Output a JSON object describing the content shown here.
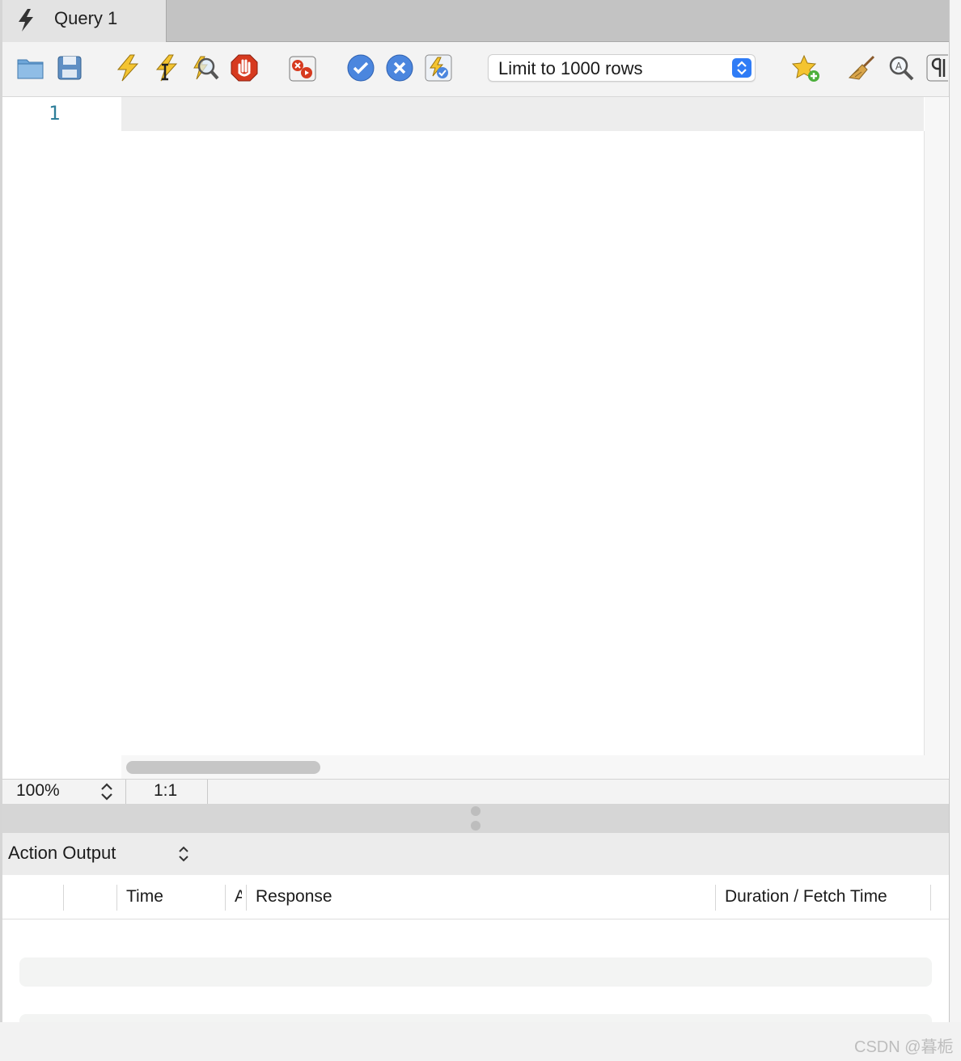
{
  "tab": {
    "label": "Query 1",
    "icon": "lightning-icon"
  },
  "toolbar": {
    "buttons": [
      {
        "name": "open-file-button",
        "icon": "folder-icon"
      },
      {
        "name": "save-button",
        "icon": "floppy-disk-icon"
      },
      {
        "name": "execute-all-button",
        "icon": "lightning-icon"
      },
      {
        "name": "execute-current-button",
        "icon": "lightning-cursor-icon"
      },
      {
        "name": "explain-button",
        "icon": "magnifier-lightning-icon"
      },
      {
        "name": "stop-button",
        "icon": "stop-hand-icon"
      },
      {
        "name": "toggle-continue-on-error-button",
        "icon": "error-toggle-icon"
      },
      {
        "name": "commit-button",
        "icon": "check-circle-icon"
      },
      {
        "name": "rollback-button",
        "icon": "x-circle-icon"
      },
      {
        "name": "autocommit-button",
        "icon": "autocommit-icon"
      },
      {
        "name": "add-snippet-button",
        "icon": "star-plus-icon"
      },
      {
        "name": "beautify-button",
        "icon": "broom-icon"
      },
      {
        "name": "find-button",
        "icon": "search-icon"
      },
      {
        "name": "invisible-chars-button",
        "icon": "pilcrow-icon"
      }
    ],
    "limit_select": {
      "value": "Limit to 1000 rows"
    }
  },
  "editor": {
    "line_numbers": [
      "1"
    ],
    "content": ""
  },
  "status": {
    "zoom": "100%",
    "cursor": "1:1"
  },
  "output": {
    "title": "Action Output",
    "columns": [
      "",
      "",
      "Time",
      "Action",
      "Response",
      "Duration / Fetch Time"
    ]
  },
  "watermark": "CSDN @暮栀",
  "colors": {
    "accent": "#2f7cf6",
    "line_number": "#2f7f9a",
    "stop": "#d63a1f"
  }
}
